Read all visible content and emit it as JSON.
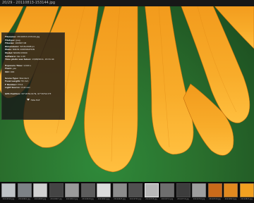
{
  "window": {
    "title": "20/29 - 20110813-153144.jpg"
  },
  "info_panel": {
    "rows": [
      {
        "label": "Filename:",
        "value": "20110813-153144.jpg"
      },
      {
        "label": "Filetype:",
        "value": "jpeg"
      },
      {
        "label": "Filesize:",
        "value": "160897 KB"
      },
      {
        "label": "Dimensions:",
        "value": "3216x2008 px"
      },
      {
        "label": "Make:",
        "value": "NIKON CORPORATION"
      },
      {
        "label": "Model:",
        "value": "NIKON D3000"
      },
      {
        "label": "Software:",
        "value": "Ver.1.00"
      },
      {
        "label": "Time photo was taken:",
        "value": "13/08/2011, 15:31:44"
      },
      {
        "label": "Exposure Time:",
        "value": "1/320 s"
      },
      {
        "label": "Flash:",
        "value": "yes"
      },
      {
        "label": "ISO:",
        "value": "400"
      },
      {
        "label": "Scene Type:",
        "value": "Standard"
      },
      {
        "label": "Focal Length:",
        "value": "55 mm"
      },
      {
        "label": "F Number:",
        "value": "F/5.6"
      },
      {
        "label": "Light Source:",
        "value": "Unknown"
      },
      {
        "label": "GPS Position:",
        "value": "30°18'59.91\"N, 97°39'54.5\"E"
      }
    ],
    "hide_label": "Hide Exif"
  },
  "filmstrip": {
    "thumbs": [
      {
        "caption": "20110516.jpg",
        "color": "#bfc3c6"
      },
      {
        "caption": "20110601.jpg",
        "color": "#7d8286"
      },
      {
        "caption": "20110605.jpg",
        "color": "#d0d0d0"
      },
      {
        "caption": "20110607.jpg",
        "color": "#444444"
      },
      {
        "caption": "20110612.jpg",
        "color": "#9a9a9a"
      },
      {
        "caption": "20110618.jpg",
        "color": "#5c5c5c"
      },
      {
        "caption": "20110621.jpg",
        "color": "#dcdcdc"
      },
      {
        "caption": "20110625.jpg",
        "color": "#8c8c8c"
      },
      {
        "caption": "20110702.jpg",
        "color": "#505050"
      },
      {
        "caption": "20110708.jpg",
        "color": "#b8b8b8"
      },
      {
        "caption": "20110711.jpg",
        "color": "#6e6e6e"
      },
      {
        "caption": "20110716.jpg",
        "color": "#3d3d3d"
      },
      {
        "caption": "20110722.jpg",
        "color": "#9e9e9e"
      },
      {
        "caption": "20110729.jpg",
        "color": "#c96a1a"
      },
      {
        "caption": "20110813.jpg",
        "color": "#e0891f"
      },
      {
        "caption": "20110815.jpg",
        "color": "#f0a020"
      }
    ]
  },
  "colors": {
    "petal": "#f5a21f",
    "petal_light": "#ffc64a",
    "petal_dark": "#c56d0c",
    "background": "#2d7a34"
  }
}
